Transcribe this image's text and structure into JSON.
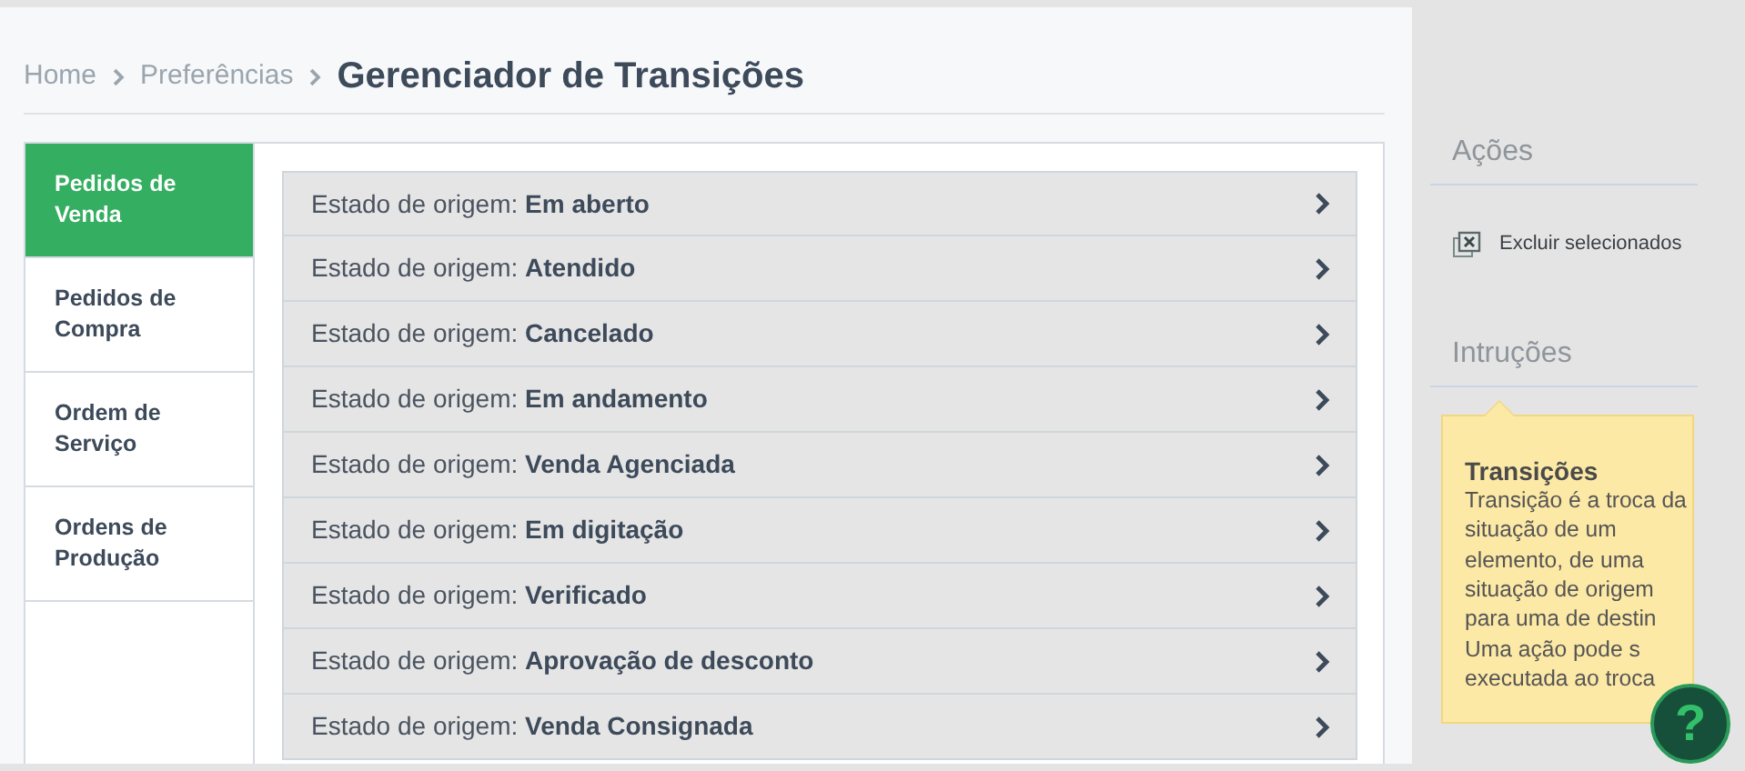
{
  "breadcrumb": [
    {
      "label": "Home"
    },
    {
      "label": "Preferências"
    }
  ],
  "title": "Gerenciador de Transições",
  "tabs": [
    {
      "label": "Pedidos de Venda",
      "selected": true
    },
    {
      "label": "Pedidos de Compra",
      "selected": false
    },
    {
      "label": "Ordem de Serviço",
      "selected": false
    },
    {
      "label": "Ordens de Produção",
      "selected": false
    }
  ],
  "rows": [
    {
      "prefix": "Estado de origem:",
      "state": "Em aberto"
    },
    {
      "prefix": "Estado de origem:",
      "state": "Atendido"
    },
    {
      "prefix": "Estado de origem:",
      "state": "Cancelado"
    },
    {
      "prefix": "Estado de origem:",
      "state": "Em andamento"
    },
    {
      "prefix": "Estado de origem:",
      "state": "Venda Agenciada"
    },
    {
      "prefix": "Estado de origem:",
      "state": "Em digitação"
    },
    {
      "prefix": "Estado de origem:",
      "state": "Verificado"
    },
    {
      "prefix": "Estado de origem:",
      "state": "Aprovação de desconto"
    },
    {
      "prefix": "Estado de origem:",
      "state": "Venda Consignada"
    }
  ],
  "actions": {
    "heading": "Ações",
    "items": [
      {
        "label": "Excluir selecionados"
      }
    ]
  },
  "instructions": {
    "heading": "Intruções",
    "title": "Transições",
    "lines": [
      "Transição é a troca da",
      "situação de um",
      "elemento, de uma",
      "situação de origem",
      "para uma de destin",
      "Uma ação pode s",
      "executada ao troca"
    ]
  },
  "help_button": {
    "label": "?"
  }
}
